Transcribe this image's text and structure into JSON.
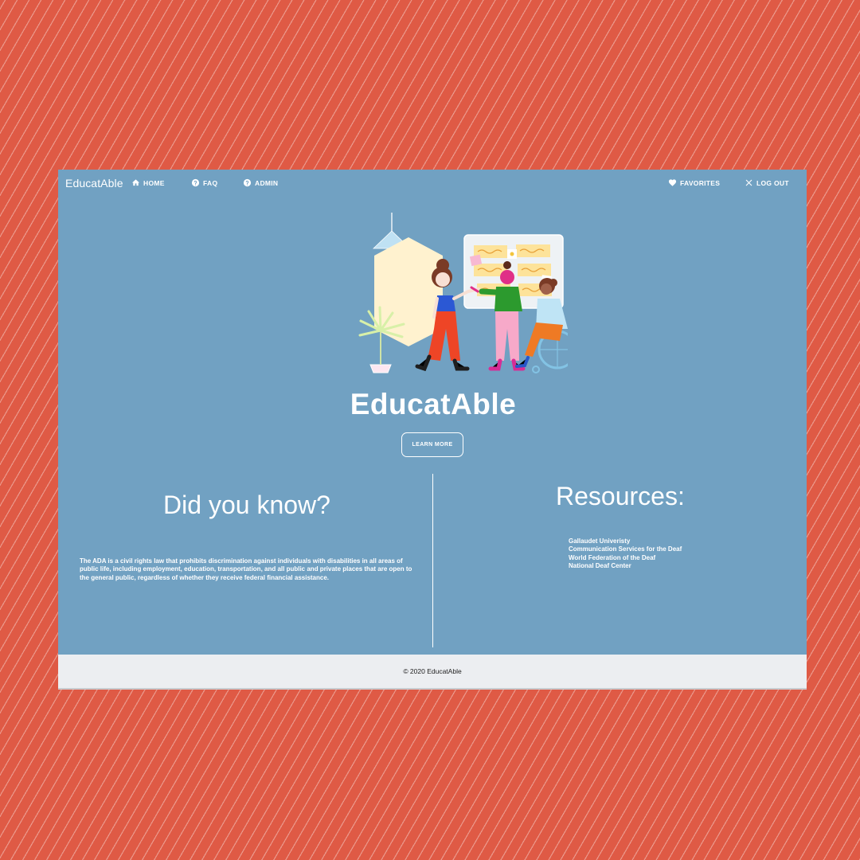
{
  "navbar": {
    "brand": "EducatAble",
    "items": [
      {
        "label": "HOME",
        "icon": "home-icon"
      },
      {
        "label": "FAQ",
        "icon": "help-circle-icon"
      },
      {
        "label": "ADMIN",
        "icon": "help-circle-icon"
      },
      {
        "label": "FAVORITES",
        "icon": "heart-icon"
      },
      {
        "label": "LOG OUT",
        "icon": "close-icon"
      }
    ]
  },
  "hero": {
    "title": "EducatAble",
    "button_label": "LEARN MORE",
    "illustration": "people-collaborating-illustration"
  },
  "did_you_know": {
    "heading": "Did you know?",
    "body": "The ADA is a civil rights law that prohibits discrimination against individuals with disabilities in all areas of public life, including employment, education, transportation, and all public and private places that are open to the general public, regardless of whether they receive federal financial assistance."
  },
  "resources": {
    "heading": "Resources:",
    "links": [
      "Gallaudet Univeristy",
      "Communication Services for the Deaf",
      "World Federation of the Deaf",
      "National Deaf Center"
    ]
  },
  "footer": {
    "copyright": "© 2020 EducatAble"
  },
  "colors": {
    "background": "#df5a45",
    "page": "#71a1c2",
    "footer": "#eceef1",
    "text": "#ffffff"
  }
}
